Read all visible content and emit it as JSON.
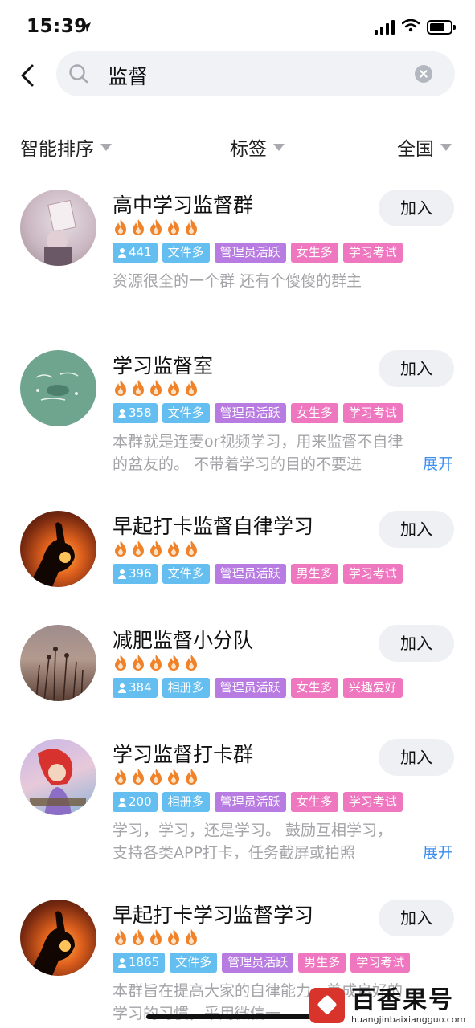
{
  "status_bar": {
    "time": "15:39"
  },
  "search": {
    "query": "监督"
  },
  "filters": [
    {
      "label": "智能排序"
    },
    {
      "label": "标签"
    },
    {
      "label": "全国"
    }
  ],
  "join_label": "加入",
  "expand_label": "展开",
  "groups": [
    {
      "name": "高中学习监督群",
      "flames": 5,
      "members": "441",
      "tags": [
        {
          "label": "文件多",
          "color": "blue"
        },
        {
          "label": "管理员活跃",
          "color": "purple"
        },
        {
          "label": "女生多",
          "color": "pink"
        },
        {
          "label": "学习考试",
          "color": "pink"
        }
      ],
      "desc_lines": [
        "资源很全的一个群 还有个傻傻的群主"
      ],
      "expandable": false
    },
    {
      "name": "学习监督室",
      "flames": 5,
      "members": "358",
      "tags": [
        {
          "label": "文件多",
          "color": "blue"
        },
        {
          "label": "管理员活跃",
          "color": "purple"
        },
        {
          "label": "女生多",
          "color": "pink"
        },
        {
          "label": "学习考试",
          "color": "pink"
        }
      ],
      "desc_lines": [
        "本群就是连麦or视频学习，用来监督不自律",
        "的盆友的。 不带着学习的目的不要进"
      ],
      "expandable": true
    },
    {
      "name": "早起打卡监督自律学习",
      "flames": 5,
      "members": "396",
      "tags": [
        {
          "label": "文件多",
          "color": "blue"
        },
        {
          "label": "管理员活跃",
          "color": "purple"
        },
        {
          "label": "男生多",
          "color": "pink"
        },
        {
          "label": "学习考试",
          "color": "pink"
        }
      ],
      "desc_lines": [],
      "expandable": false
    },
    {
      "name": "减肥监督小分队",
      "flames": 5,
      "members": "384",
      "tags": [
        {
          "label": "相册多",
          "color": "blue"
        },
        {
          "label": "管理员活跃",
          "color": "purple"
        },
        {
          "label": "女生多",
          "color": "pink"
        },
        {
          "label": "兴趣爱好",
          "color": "pink"
        }
      ],
      "desc_lines": [],
      "expandable": false
    },
    {
      "name": "学习监督打卡群",
      "flames": 5,
      "members": "200",
      "tags": [
        {
          "label": "相册多",
          "color": "blue"
        },
        {
          "label": "管理员活跃",
          "color": "purple"
        },
        {
          "label": "女生多",
          "color": "pink"
        },
        {
          "label": "学习考试",
          "color": "pink"
        }
      ],
      "desc_lines": [
        "学习，学习，还是学习。 鼓励互相学习，",
        "支持各类APP打卡，任务截屏或拍照"
      ],
      "expandable": true
    },
    {
      "name": "早起打卡学习监督学习",
      "flames": 5,
      "members": "1865",
      "tags": [
        {
          "label": "文件多",
          "color": "blue"
        },
        {
          "label": "管理员活跃",
          "color": "purple"
        },
        {
          "label": "男生多",
          "color": "pink"
        },
        {
          "label": "学习考试",
          "color": "pink"
        }
      ],
      "desc_lines": [
        "本群旨在提高大家的自律能力，养成良好的",
        "学习的习惯，采用微信一"
      ],
      "expandable": false
    }
  ],
  "watermark": {
    "title": "百香果号",
    "url": "huangjinbaixiangguo.com"
  },
  "colors": {
    "accent": "#3b8ef0",
    "tag_blue": "#64bff0",
    "tag_purple": "#b77be2",
    "tag_pink": "#ee77bf",
    "flame": "#f0822a"
  }
}
